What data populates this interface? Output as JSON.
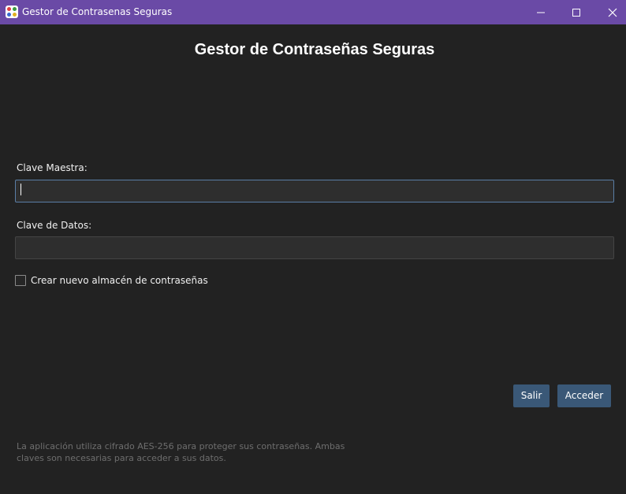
{
  "window": {
    "title": "Gestor de Contrasenas Seguras"
  },
  "header": {
    "title": "Gestor de Contraseñas Seguras"
  },
  "form": {
    "master_label": "Clave Maestra:",
    "master_value": "",
    "data_label": "Clave de Datos:",
    "data_value": "",
    "checkbox_label": "Crear nuevo almacén de contraseñas",
    "checkbox_checked": false
  },
  "buttons": {
    "exit": "Salir",
    "access": "Acceder"
  },
  "footer": {
    "line1": "La aplicación utiliza cifrado AES-256 para proteger sus contraseñas. Ambas",
    "line2": "claves son necesarias para acceder a sus datos."
  },
  "colors": {
    "titlebar": "#6a4aa6",
    "background": "#222222",
    "button": "#3a5877",
    "focus_border": "#5a7ea6"
  }
}
